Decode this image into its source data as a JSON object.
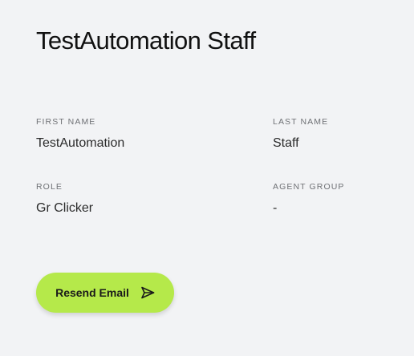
{
  "profile": {
    "title": "TestAutomation Staff",
    "fields": {
      "first_name": {
        "label": "FIRST NAME",
        "value": "TestAutomation"
      },
      "last_name": {
        "label": "LAST NAME",
        "value": "Staff"
      },
      "role": {
        "label": "ROLE",
        "value": "Gr Clicker"
      },
      "agent_group": {
        "label": "AGENT GROUP",
        "value": "-"
      }
    },
    "actions": {
      "resend_label": "Resend Email",
      "resend_icon": "send-icon"
    }
  },
  "colors": {
    "background": "#f2f3f5",
    "accent": "#b5e94a",
    "label": "#6f7175",
    "text": "#2b2b2b"
  }
}
